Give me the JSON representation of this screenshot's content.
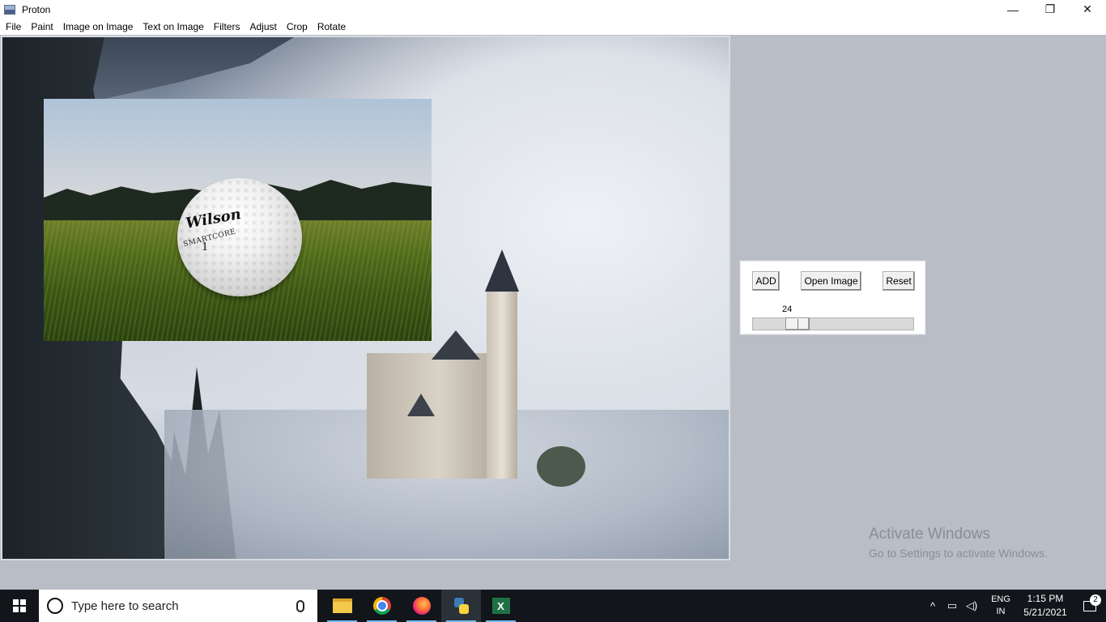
{
  "window": {
    "title": "Proton",
    "controls": {
      "minimize": "—",
      "maximize": "❐",
      "close": "✕"
    }
  },
  "menu": {
    "items": [
      {
        "label": "File"
      },
      {
        "label": "Paint"
      },
      {
        "label": "Image on Image"
      },
      {
        "label": "Text on Image"
      },
      {
        "label": "Filters"
      },
      {
        "label": "Adjust"
      },
      {
        "label": "Crop"
      },
      {
        "label": "Rotate"
      }
    ]
  },
  "canvas": {
    "base_image": "castle-in-fog-photo",
    "overlay_image": {
      "subject": "golf-ball-on-grass-photo",
      "ball_brand": "Wilson",
      "ball_model": "SMARTCORE",
      "ball_number": "1"
    }
  },
  "panel": {
    "add_label": "ADD",
    "open_label": "Open Image",
    "reset_label": "Reset",
    "slider": {
      "value": "24",
      "fraction": 0.24
    }
  },
  "watermark": {
    "title": "Activate Windows",
    "subtitle": "Go to Settings to activate Windows."
  },
  "taskbar": {
    "search_placeholder": "Type here to search",
    "apps": [
      {
        "name": "file-explorer"
      },
      {
        "name": "chrome"
      },
      {
        "name": "firefox"
      },
      {
        "name": "python",
        "active": true
      },
      {
        "name": "excel"
      }
    ],
    "tray": {
      "lang_line1": "ENG",
      "lang_line2": "IN",
      "time": "1:15 PM",
      "date": "5/21/2021",
      "notification_count": "2"
    }
  },
  "colors": {
    "client_bg": "#b8bdc6",
    "taskbar_bg": "#12151a",
    "accent": "#76b9ed"
  }
}
